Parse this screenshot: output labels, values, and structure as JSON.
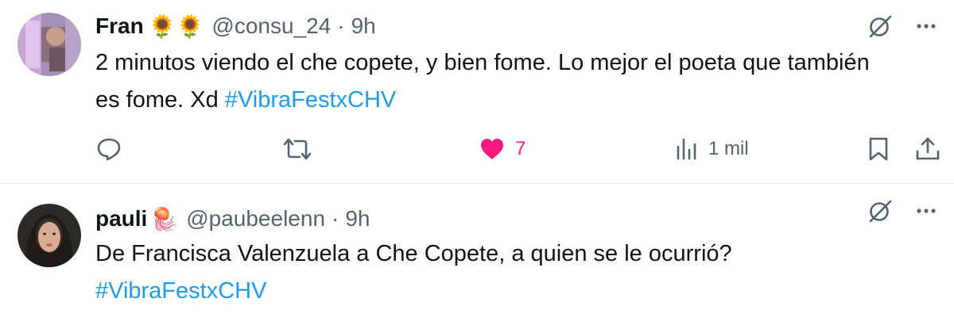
{
  "tweets": [
    {
      "author_name": "Fran",
      "author_emoji": "🌻🌻",
      "handle": "@consu_24",
      "separator": "·",
      "time": "9h",
      "text_line1": "2 minutos viendo el che copete, y bien fome. Lo mejor el poeta que también",
      "text_line2": "es fome. Xd",
      "hashtag": "#VibraFestxCHV",
      "likes": "7",
      "views": "1 mil",
      "liked": true
    },
    {
      "author_name": "pauli",
      "author_emoji": "🪼",
      "handle": "@paubeelenn",
      "separator": "·",
      "time": "9h",
      "text_line1": "De Francisca Valenzuela a Che Copete, a quien se le ocurrió?",
      "hashtag": "#VibraFestxCHV"
    }
  ],
  "icons": {
    "reply": "reply-icon",
    "retweet": "retweet-icon",
    "like": "heart-filled-icon",
    "views": "views-chart-icon",
    "bookmark": "bookmark-icon",
    "share": "share-icon",
    "grok": "grok-icon",
    "more": "more-icon"
  },
  "colors": {
    "text": "#0f1419",
    "secondary": "#536471",
    "link": "#1d9bf0",
    "like": "#f91880",
    "divider": "#eff3f4"
  }
}
